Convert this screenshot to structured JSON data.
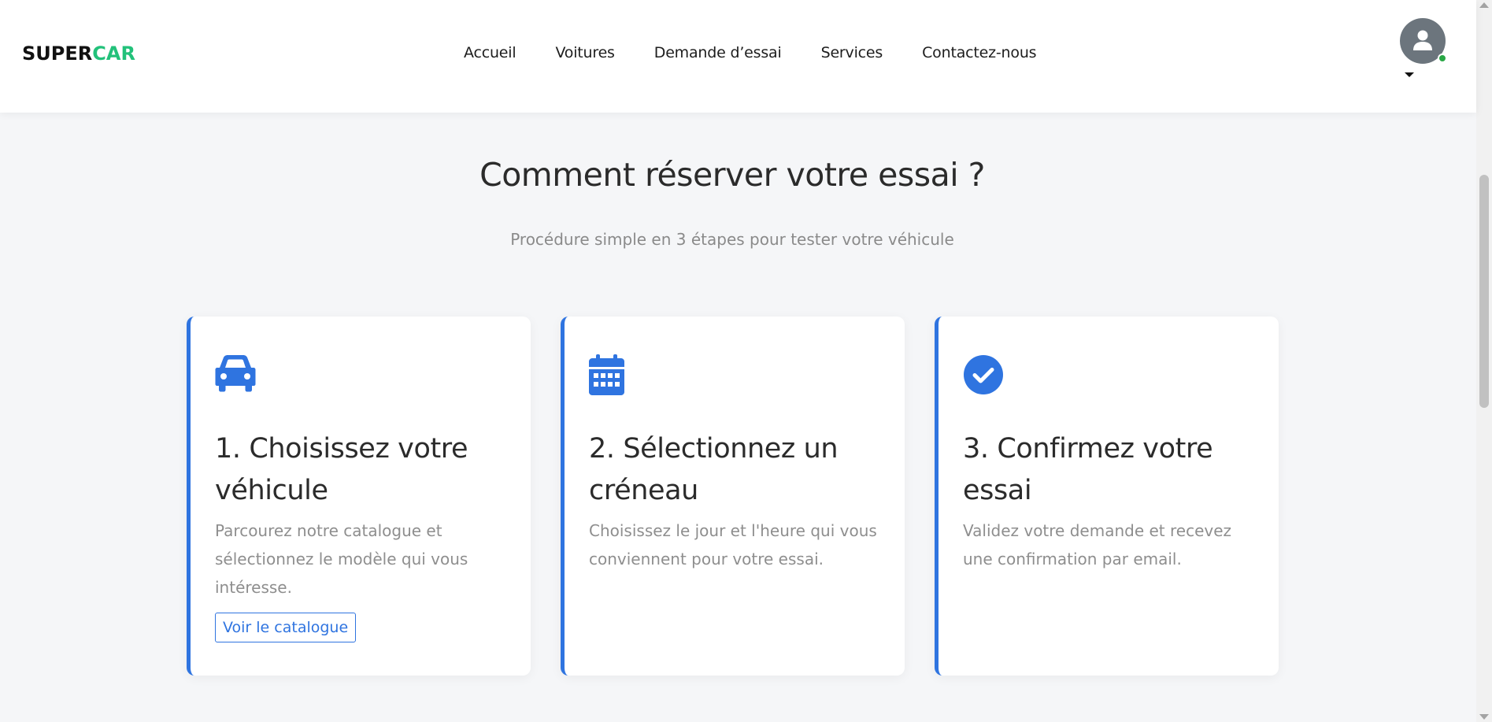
{
  "header": {
    "logo_part1": "SUPER",
    "logo_part2": "CAR",
    "nav": [
      "Accueil",
      "Voitures",
      "Demande d’essai",
      "Services",
      "Contactez-nous"
    ]
  },
  "section": {
    "title": "Comment réserver votre essai ?",
    "subtitle": "Procédure simple en 3 étapes pour tester votre véhicule"
  },
  "steps": [
    {
      "icon": "car-icon",
      "title": "1. Choisissez votre véhicule",
      "text": "Parcourez notre catalogue et sélectionnez le modèle qui vous intéresse.",
      "button": "Voir le catalogue"
    },
    {
      "icon": "calendar-icon",
      "title": "2. Sélectionnez un créneau",
      "text": "Choisissez le jour et l'heure qui vous conviennent pour votre essai."
    },
    {
      "icon": "check-circle-icon",
      "title": "3. Confirmez votre essai",
      "text": "Validez votre demande et recevez une confirmation par email."
    }
  ],
  "colors": {
    "accent": "#2f74e0",
    "brand_green": "#22c17a",
    "online": "#28a745",
    "avatar_bg": "#6c757d"
  }
}
